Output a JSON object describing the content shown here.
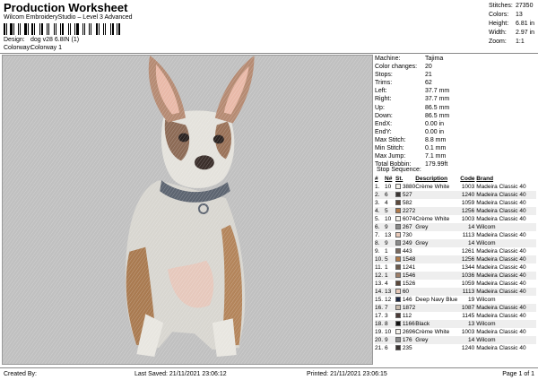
{
  "header": {
    "title": "Production Worksheet",
    "subtitle": "Wilcom EmbroideryStudio – Level 3 Advanced",
    "design_label": "Design:",
    "design_value": "dog v28 6.8IN (1)",
    "colorway_label": "Colorway:",
    "colorway_value": "Colorway 1"
  },
  "summary": [
    {
      "k": "Stitches:",
      "v": "27350"
    },
    {
      "k": "Colors:",
      "v": "13"
    },
    {
      "k": "Height:",
      "v": "6.81 in"
    },
    {
      "k": "Width:",
      "v": "2.97 in"
    },
    {
      "k": "Zoom:",
      "v": "1:1"
    }
  ],
  "machine_info": [
    {
      "k": "Machine:",
      "v": "Tajima"
    },
    {
      "k": "Color changes:",
      "v": "20"
    },
    {
      "k": "Stops:",
      "v": "21"
    },
    {
      "k": "Trims:",
      "v": "62"
    },
    {
      "k": "Left:",
      "v": "37.7 mm"
    },
    {
      "k": "Right:",
      "v": "37.7 mm"
    },
    {
      "k": "Up:",
      "v": "86.5 mm"
    },
    {
      "k": "Down:",
      "v": "86.5 mm"
    },
    {
      "k": "EndX:",
      "v": "0.00 in"
    },
    {
      "k": "EndY:",
      "v": "0.00 in"
    },
    {
      "k": "Max Stitch:",
      "v": "8.8 mm"
    },
    {
      "k": "Min Stitch:",
      "v": "0.1 mm"
    },
    {
      "k": "Max Jump:",
      "v": "7.1 mm"
    },
    {
      "k": "Total Bobbin:",
      "v": "179.99ft"
    }
  ],
  "stop_sequence": {
    "title": "Stop Sequence:",
    "headers": [
      "#",
      "N#",
      "St.",
      "Description",
      "Code",
      "Brand"
    ],
    "rows": [
      {
        "num": "1.",
        "n": "10",
        "st": "3880",
        "desc": "Crème White",
        "code": "1003",
        "brand": "Madeira Classic 40",
        "color": "#f4f1ea"
      },
      {
        "num": "2.",
        "n": "6",
        "st": "527",
        "desc": "",
        "code": "1240",
        "brand": "Madeira Classic 40",
        "color": "#3a3432"
      },
      {
        "num": "3.",
        "n": "4",
        "st": "582",
        "desc": "",
        "code": "1059",
        "brand": "Madeira Classic 40",
        "color": "#5e4a3c"
      },
      {
        "num": "4.",
        "n": "5",
        "st": "2272",
        "desc": "",
        "code": "1256",
        "brand": "Madeira Classic 40",
        "color": "#b07a4a"
      },
      {
        "num": "5.",
        "n": "10",
        "st": "6074",
        "desc": "Crème White",
        "code": "1003",
        "brand": "Madeira Classic 40",
        "color": "#f4f1ea"
      },
      {
        "num": "6.",
        "n": "9",
        "st": "267",
        "desc": "Grey",
        "code": "14",
        "brand": "Wilcom",
        "color": "#8a8a8a"
      },
      {
        "num": "7.",
        "n": "13",
        "st": "730",
        "desc": "",
        "code": "1113",
        "brand": "Madeira Classic 40",
        "color": "#e8c9b8"
      },
      {
        "num": "8.",
        "n": "9",
        "st": "249",
        "desc": "Grey",
        "code": "14",
        "brand": "Wilcom",
        "color": "#8a8a8a"
      },
      {
        "num": "9.",
        "n": "1",
        "st": "443",
        "desc": "",
        "code": "1261",
        "brand": "Madeira Classic 40",
        "color": "#7a6a60"
      },
      {
        "num": "10.",
        "n": "5",
        "st": "1548",
        "desc": "",
        "code": "1256",
        "brand": "Madeira Classic 40",
        "color": "#b07a4a"
      },
      {
        "num": "11.",
        "n": "1",
        "st": "1241",
        "desc": "",
        "code": "1344",
        "brand": "Madeira Classic 40",
        "color": "#6b5a4c"
      },
      {
        "num": "12.",
        "n": "1",
        "st": "1546",
        "desc": "",
        "code": "1036",
        "brand": "Madeira Classic 40",
        "color": "#9e7e68"
      },
      {
        "num": "13.",
        "n": "4",
        "st": "1526",
        "desc": "",
        "code": "1059",
        "brand": "Madeira Classic 40",
        "color": "#5e4a3c"
      },
      {
        "num": "14.",
        "n": "13",
        "st": "60",
        "desc": "",
        "code": "1113",
        "brand": "Madeira Classic 40",
        "color": "#e8c9b8"
      },
      {
        "num": "15.",
        "n": "12",
        "st": "146",
        "desc": "Deep Navy Blue",
        "code": "19",
        "brand": "Wilcom",
        "color": "#1f2a44"
      },
      {
        "num": "16.",
        "n": "7",
        "st": "1872",
        "desc": "",
        "code": "1087",
        "brand": "Madeira Classic 40",
        "color": "#c9bcae"
      },
      {
        "num": "17.",
        "n": "3",
        "st": "112",
        "desc": "",
        "code": "1145",
        "brand": "Madeira Classic 40",
        "color": "#4a3a36"
      },
      {
        "num": "18.",
        "n": "8",
        "st": "1166",
        "desc": "Black",
        "code": "13",
        "brand": "Wilcom",
        "color": "#111111"
      },
      {
        "num": "19.",
        "n": "10",
        "st": "2696",
        "desc": "Crème White",
        "code": "1003",
        "brand": "Madeira Classic 40",
        "color": "#f4f1ea"
      },
      {
        "num": "20.",
        "n": "9",
        "st": "176",
        "desc": "Grey",
        "code": "14",
        "brand": "Wilcom",
        "color": "#8a8a8a"
      },
      {
        "num": "21.",
        "n": "6",
        "st": "235",
        "desc": "",
        "code": "1240",
        "brand": "Madeira Classic 40",
        "color": "#3a3432"
      }
    ]
  },
  "footer": {
    "created_by": "Created By:",
    "last_saved": "Last Saved: 21/11/2021 23:06:12",
    "printed": "Printed: 21/11/2021 23:06:15",
    "page": "Page 1 of 1"
  },
  "design_preview": {
    "background": "#c0c0c0"
  }
}
